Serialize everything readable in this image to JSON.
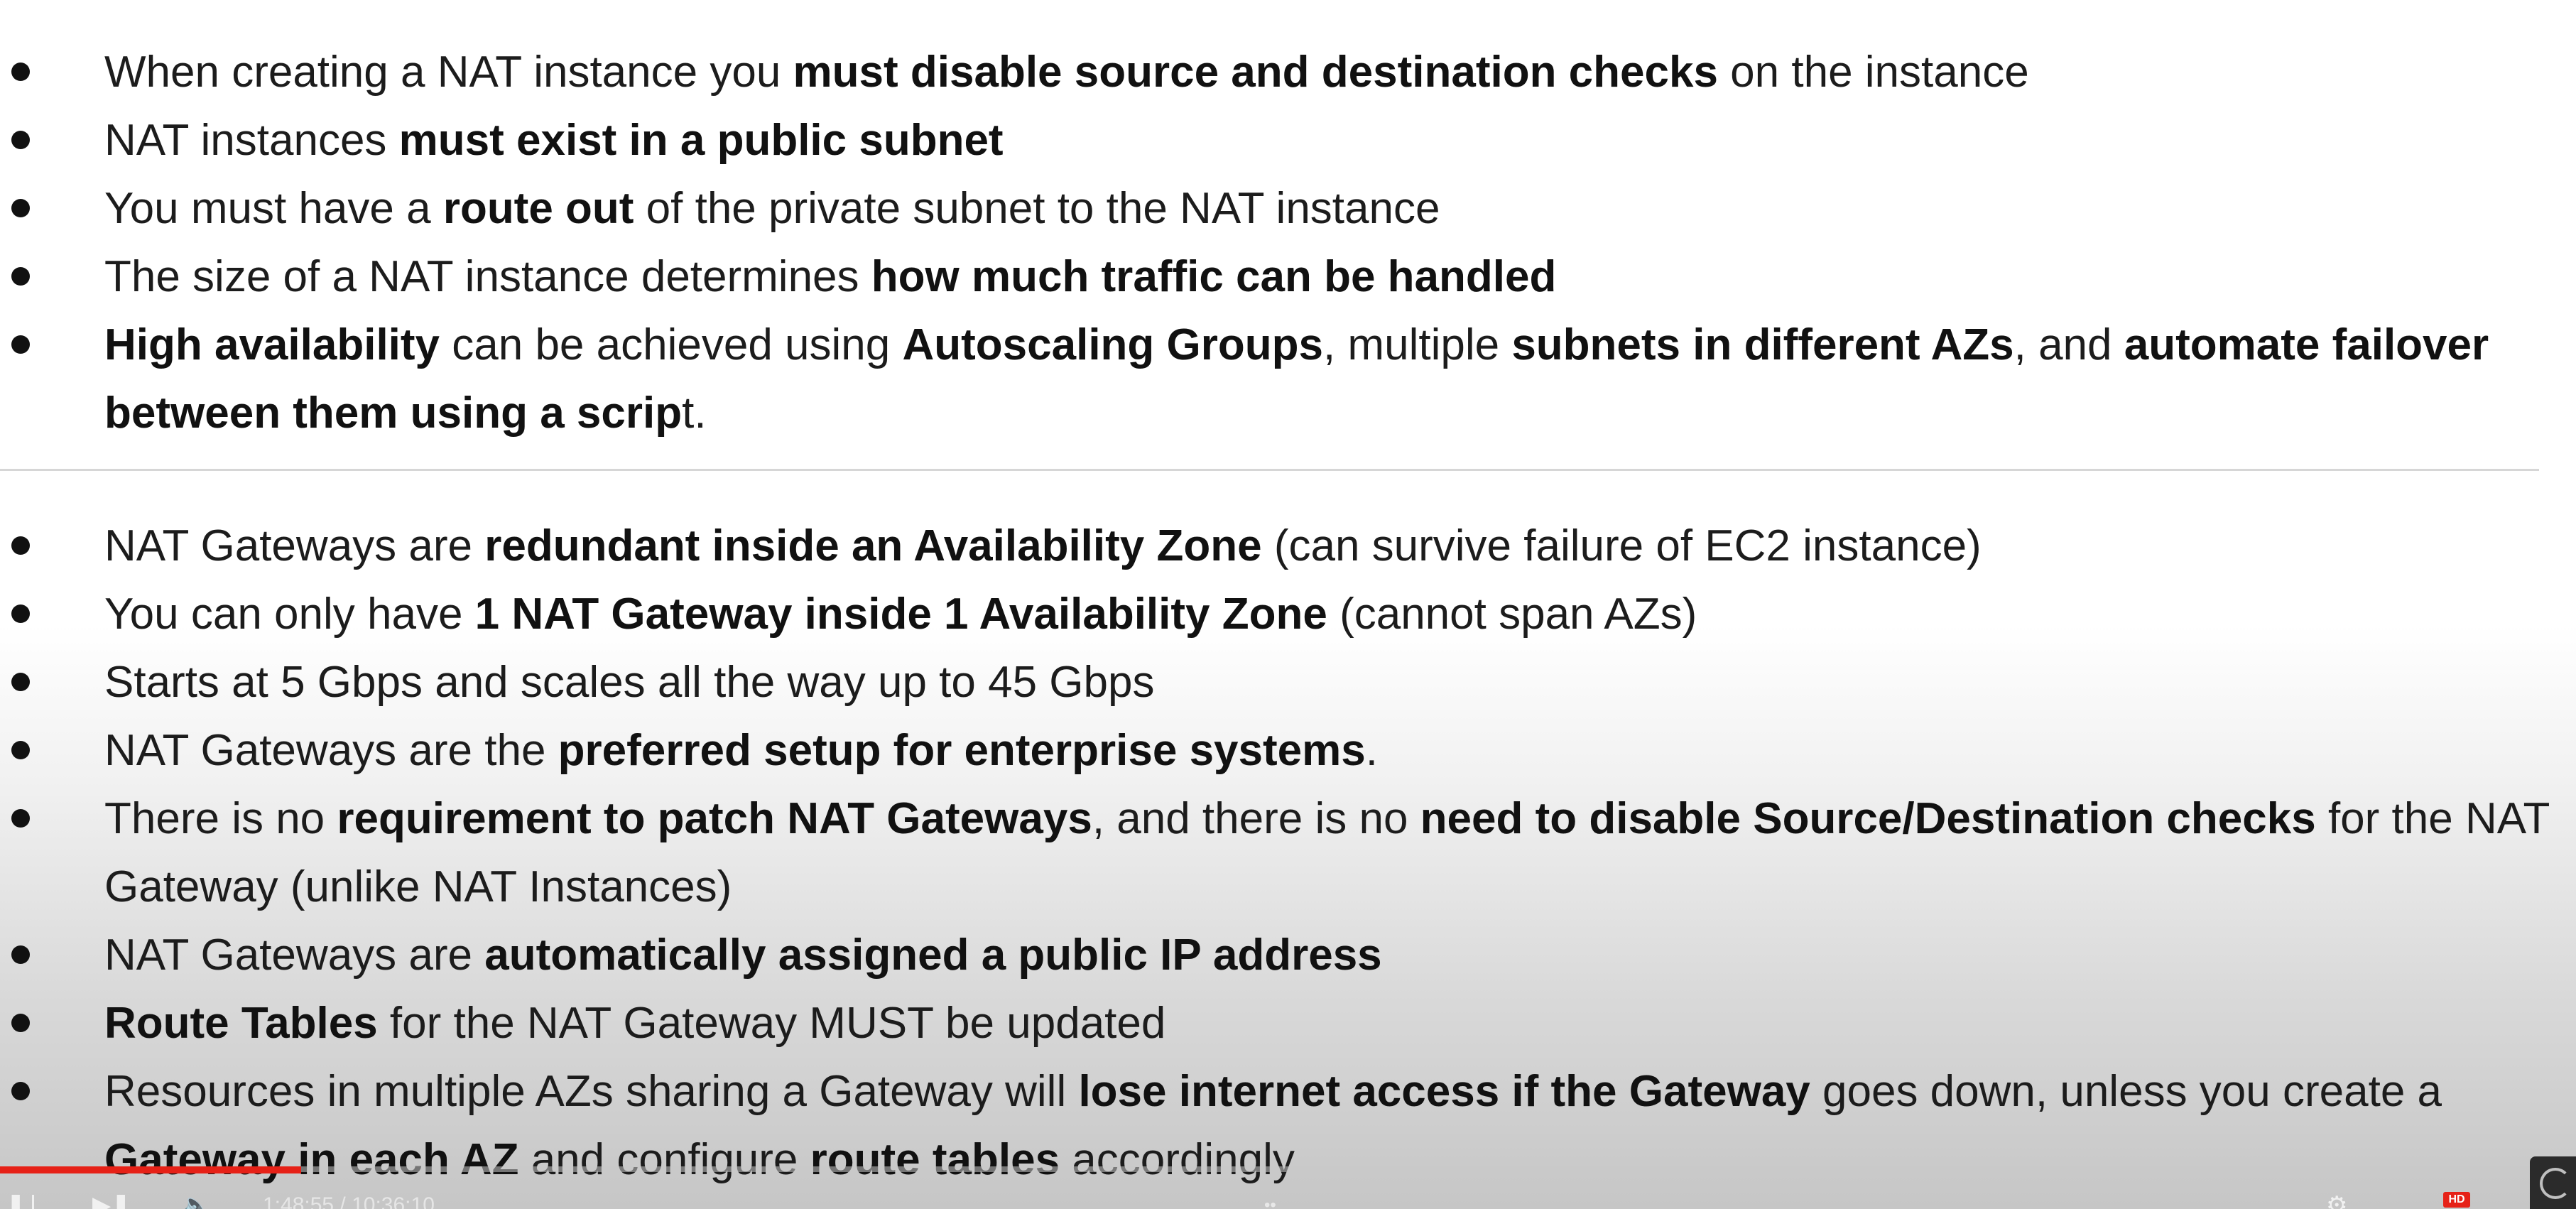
{
  "nat_instance_bullets": [
    {
      "parts": [
        {
          "text": "When creating a NAT instance you ",
          "bold": false
        },
        {
          "text": "must disable source and destination checks",
          "bold": true
        },
        {
          "text": " on the instance",
          "bold": false
        }
      ]
    },
    {
      "parts": [
        {
          "text": "NAT instances ",
          "bold": false
        },
        {
          "text": "must exist in a public subnet",
          "bold": true
        }
      ]
    },
    {
      "parts": [
        {
          "text": "You must have a ",
          "bold": false
        },
        {
          "text": "route out",
          "bold": true
        },
        {
          "text": " of the private subnet to the NAT instance",
          "bold": false
        }
      ]
    },
    {
      "parts": [
        {
          "text": "The size of a NAT instance determines ",
          "bold": false
        },
        {
          "text": "how much traffic can be handled",
          "bold": true
        }
      ]
    },
    {
      "parts": [
        {
          "text": "High availability",
          "bold": true
        },
        {
          "text": " can be achieved using ",
          "bold": false
        },
        {
          "text": "Autoscaling Groups",
          "bold": true
        },
        {
          "text": ", multiple ",
          "bold": false
        },
        {
          "text": "subnets in different AZs",
          "bold": true
        },
        {
          "text": ", and ",
          "bold": false
        },
        {
          "text": "automate failover between them using a scrip",
          "bold": true
        },
        {
          "text": "t.",
          "bold": false
        }
      ]
    }
  ],
  "nat_gateway_bullets": [
    {
      "parts": [
        {
          "text": "NAT Gateways are ",
          "bold": false
        },
        {
          "text": "redundant inside an Availability Zone",
          "bold": true
        },
        {
          "text": "  (can survive failure of EC2 instance)",
          "bold": false
        }
      ]
    },
    {
      "parts": [
        {
          "text": "You can only have ",
          "bold": false
        },
        {
          "text": "1 NAT Gateway inside 1 Availability Zone",
          "bold": true
        },
        {
          "text": " (cannot span AZs)",
          "bold": false
        }
      ]
    },
    {
      "parts": [
        {
          "text": "Starts at 5 Gbps and scales all the way up to 45 Gbps",
          "bold": false
        }
      ]
    },
    {
      "parts": [
        {
          "text": "NAT Gateways are the ",
          "bold": false
        },
        {
          "text": "preferred setup for enterprise systems",
          "bold": true
        },
        {
          "text": ".",
          "bold": false
        }
      ]
    },
    {
      "parts": [
        {
          "text": "There is no ",
          "bold": false
        },
        {
          "text": "requirement to patch NAT Gateways",
          "bold": true
        },
        {
          "text": ", and there is no ",
          "bold": false
        },
        {
          "text": "need to disable Source/Destination checks",
          "bold": true
        },
        {
          "text": " for the NAT Gateway (unlike NAT Instances)",
          "bold": false
        }
      ]
    },
    {
      "parts": [
        {
          "text": "NAT Gateways are ",
          "bold": false
        },
        {
          "text": "automatically assigned a public IP address",
          "bold": true
        }
      ]
    },
    {
      "parts": [
        {
          "text": "Route Tables",
          "bold": true
        },
        {
          "text": " for the NAT Gateway MUST be updated",
          "bold": false
        }
      ]
    },
    {
      "parts": [
        {
          "text": "Resources in multiple AZs sharing a Gateway will ",
          "bold": false
        },
        {
          "text": "lose internet access if the Gateway",
          "bold": true
        },
        {
          "text": " goes down, unless you create a ",
          "bold": false
        },
        {
          "text": "Gateway in each AZ",
          "bold": true
        },
        {
          "text": " and configure ",
          "bold": false
        },
        {
          "text": "route tables",
          "bold": true
        },
        {
          "text": " accordingly",
          "bold": false
        }
      ]
    }
  ],
  "player": {
    "progress_fraction": 0.117,
    "time_display": "1:48:55 / 10:36:10",
    "hd_label": "HD",
    "accent_color": "#e62117"
  },
  "icons": {
    "play": "play-icon",
    "next": "next-icon",
    "volume": "volume-icon",
    "settings": "settings-icon",
    "corner": "loading-icon"
  }
}
